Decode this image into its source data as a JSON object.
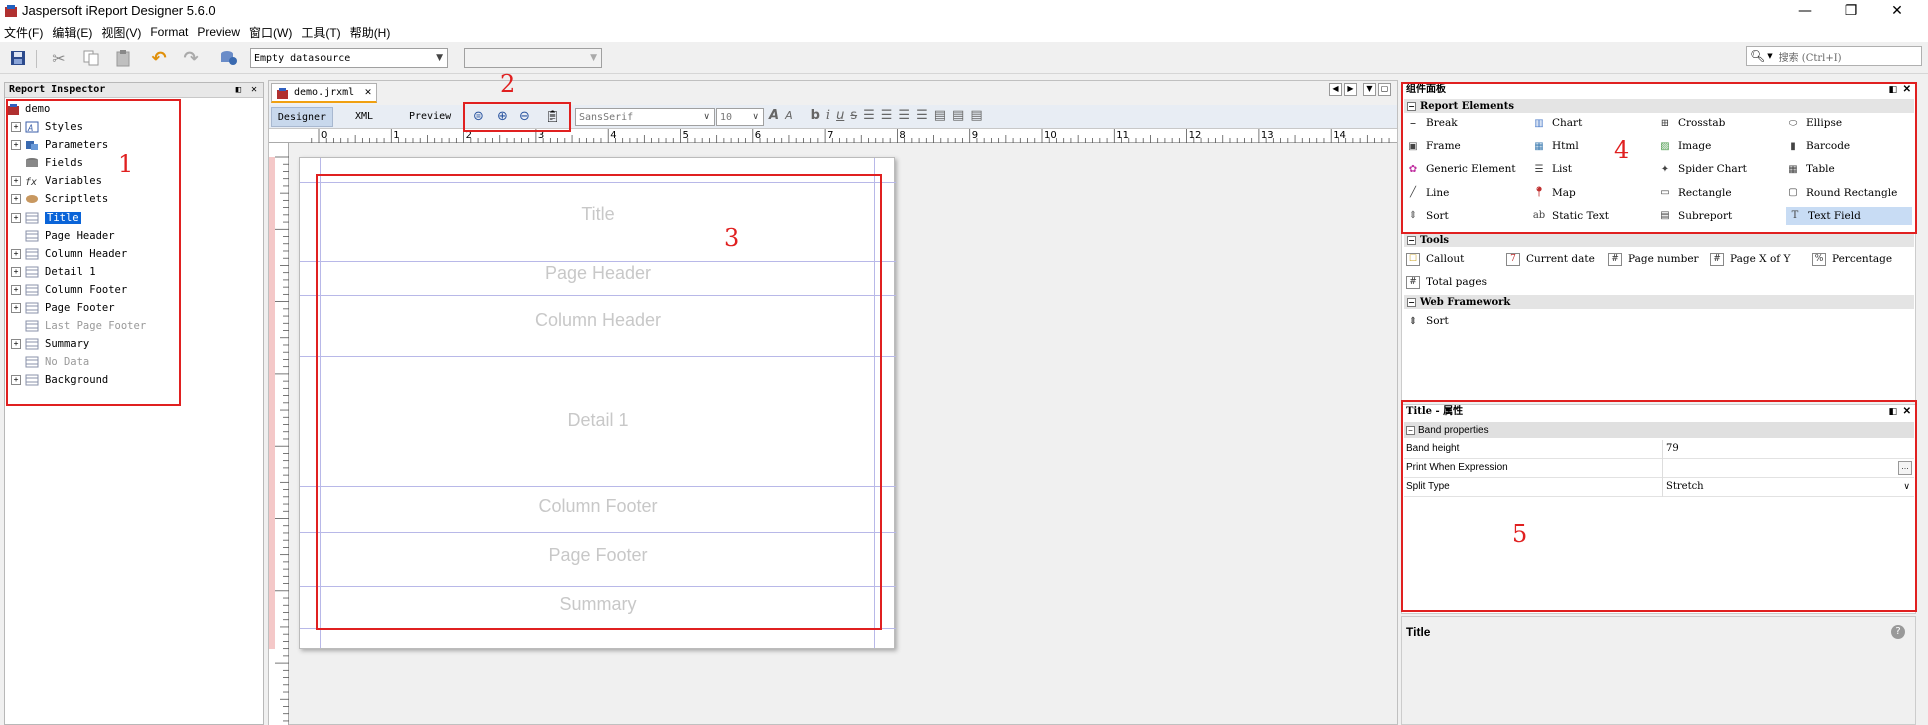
{
  "window": {
    "title": "Jaspersoft iReport Designer 5.6.0"
  },
  "menu": [
    "文件(F)",
    "编辑(E)",
    "视图(V)",
    "Format",
    "Preview",
    "窗口(W)",
    "工具(T)",
    "帮助(H)"
  ],
  "toolbar": {
    "datasource": "Empty datasource",
    "search_placeholder": "搜索 (Ctrl+I)"
  },
  "inspector": {
    "title": "Report Inspector",
    "root": "demo",
    "items": [
      {
        "label": "Styles",
        "expand": true,
        "icon": "styles-icon",
        "disabled": false
      },
      {
        "label": "Parameters",
        "expand": true,
        "icon": "parameters-icon",
        "disabled": false
      },
      {
        "label": "Fields",
        "expand": false,
        "icon": "fields-icon",
        "disabled": false
      },
      {
        "label": "Variables",
        "expand": true,
        "icon": "variables-icon",
        "disabled": false
      },
      {
        "label": "Scriptlets",
        "expand": true,
        "icon": "scriptlets-icon",
        "disabled": false
      },
      {
        "label": "Title",
        "expand": true,
        "icon": "band-icon",
        "disabled": false,
        "selected": true
      },
      {
        "label": "Page Header",
        "expand": false,
        "icon": "band-icon",
        "disabled": false
      },
      {
        "label": "Column Header",
        "expand": true,
        "icon": "band-icon",
        "disabled": false
      },
      {
        "label": "Detail 1",
        "expand": true,
        "icon": "band-icon",
        "disabled": false
      },
      {
        "label": "Column Footer",
        "expand": true,
        "icon": "band-icon",
        "disabled": false
      },
      {
        "label": "Page Footer",
        "expand": true,
        "icon": "band-icon",
        "disabled": false
      },
      {
        "label": "Last Page Footer",
        "expand": false,
        "icon": "band-icon",
        "disabled": true
      },
      {
        "label": "Summary",
        "expand": true,
        "icon": "band-icon",
        "disabled": false
      },
      {
        "label": "No Data",
        "expand": false,
        "icon": "band-icon",
        "disabled": true
      },
      {
        "label": "Background",
        "expand": true,
        "icon": "band-icon",
        "disabled": false
      }
    ]
  },
  "editor": {
    "file_tab": "demo.jrxml",
    "view_tabs": [
      "Designer",
      "XML",
      "Preview"
    ],
    "font_name": "SansSerif",
    "font_size": "10",
    "ruler": [
      "0",
      "1",
      "2",
      "3",
      "4",
      "5",
      "6",
      "7",
      "8",
      "9",
      "10",
      "11",
      "12",
      "13",
      "14"
    ],
    "bands": [
      "Title",
      "Page Header",
      "Column Header",
      "Detail 1",
      "Column Footer",
      "Page Footer",
      "Summary"
    ]
  },
  "palette": {
    "title": "组件面板",
    "sections": {
      "report_elements": "Report Elements",
      "tools": "Tools",
      "web_framework": "Web Framework"
    },
    "report_elements": [
      [
        "Break",
        "Chart",
        "Crosstab",
        "Ellipse"
      ],
      [
        "Frame",
        "Html",
        "Image",
        "Barcode"
      ],
      [
        "Generic Element",
        "List",
        "Spider Chart",
        "Table"
      ],
      [
        "Line",
        "Map",
        "Rectangle",
        "Round Rectangle"
      ],
      [
        "Sort",
        "Static Text",
        "Subreport",
        "Text Field"
      ]
    ],
    "tools": [
      "Callout",
      "Current date",
      "Page number",
      "Page X of Y",
      "Percentage",
      "Total pages"
    ],
    "web": [
      "Sort"
    ]
  },
  "properties": {
    "title": "Title - 属性",
    "section": "Band properties",
    "rows": [
      {
        "key": "Band height",
        "value": "79"
      },
      {
        "key": "Print When Expression",
        "value": ""
      },
      {
        "key": "Split Type",
        "value": "Stretch"
      }
    ],
    "footer_title": "Title"
  },
  "annotations": [
    "1",
    "2",
    "3",
    "4",
    "5"
  ],
  "colors": {
    "annotation": "#e02020",
    "selection": "#0a64d8"
  }
}
